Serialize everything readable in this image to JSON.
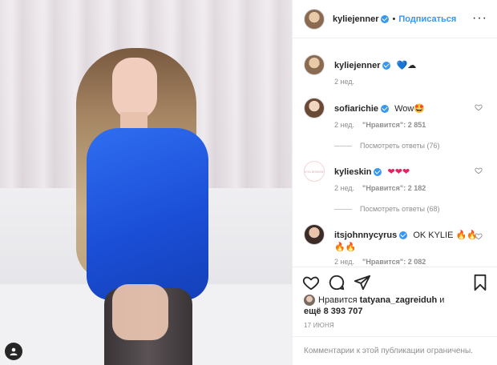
{
  "post": {
    "author": "kyliejenner",
    "follow_label": "Подписаться",
    "separator": "•",
    "more_glyph": "···"
  },
  "caption": {
    "username": "kyliejenner",
    "text": "💙☁",
    "time": "2 нед."
  },
  "comments": [
    {
      "username": "sofiarichie",
      "text": "Wow🤩",
      "time": "2 нед.",
      "likes": "\"Нравится\": 2 851",
      "replies": "Посмотреть ответы (76)"
    },
    {
      "username": "kylieskin",
      "text": "❤❤❤",
      "time": "2 нед.",
      "likes": "\"Нравится\": 2 182",
      "replies": "Посмотреть ответы (68)",
      "avatar_text": "KYLIESKIN"
    },
    {
      "username": "itsjohnnycyrus",
      "text": "OK KYLIE 🔥🔥",
      "text2": "🔥🔥",
      "time": "2 нед.",
      "likes": "\"Нравится\": 2 082"
    }
  ],
  "likes": {
    "prefix": "Нравится",
    "user": "tatyana_zagreiduh",
    "conj": "и",
    "rest": "ещё 8 393 707"
  },
  "date": "17 ИЮНЯ",
  "footer": "Комментарии к этой публикации ограничены.",
  "icons": {
    "heart": "heart-icon",
    "comment": "comment-icon",
    "share": "share-icon",
    "bookmark": "bookmark-icon",
    "user_tag": "user-tag-icon"
  },
  "colors": {
    "accent": "#3897f0",
    "dress": "#1b4fd8"
  }
}
